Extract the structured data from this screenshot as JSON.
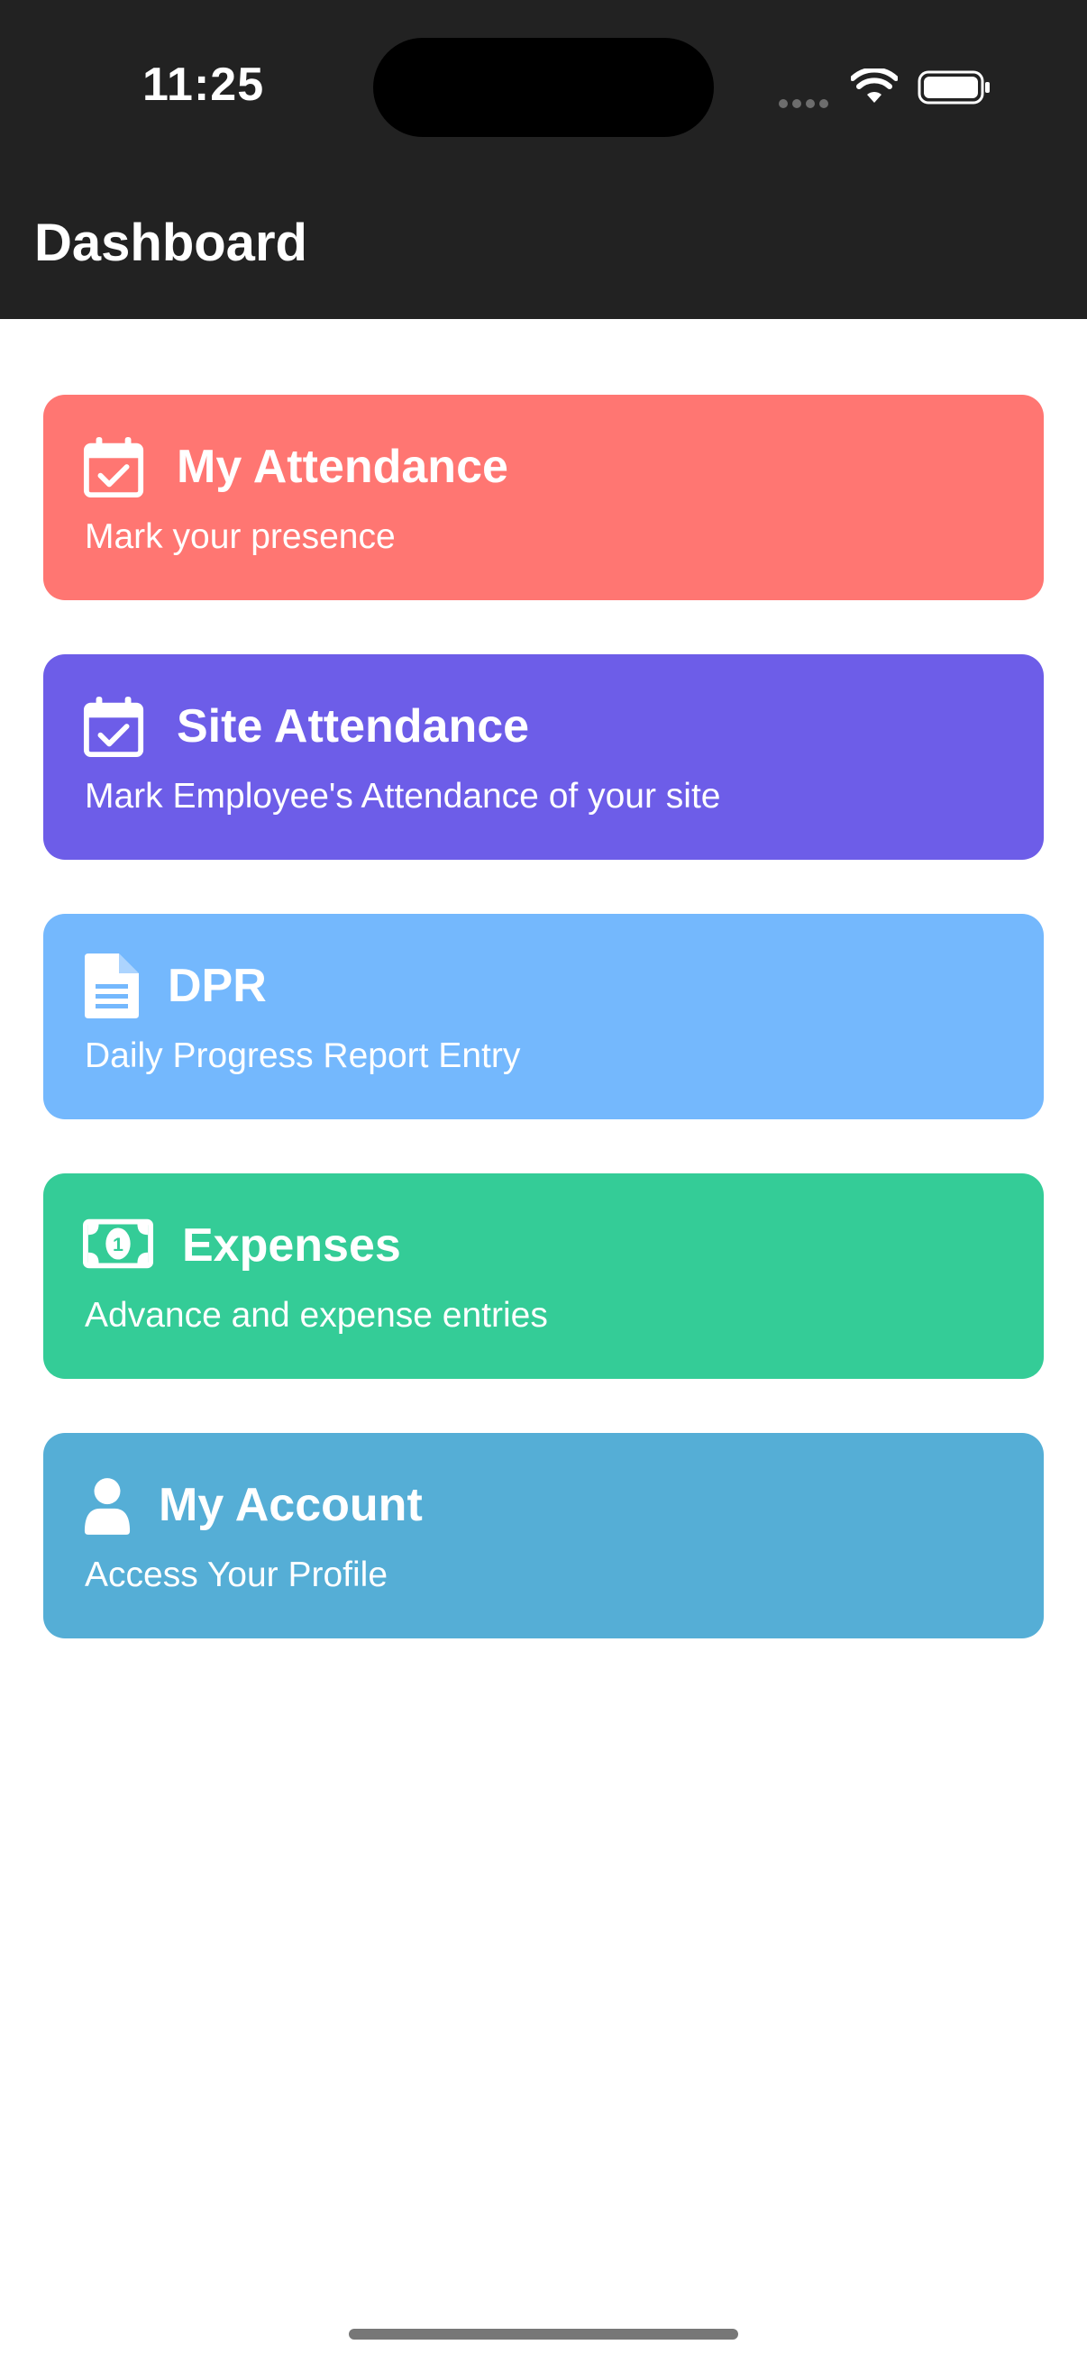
{
  "status_bar": {
    "time": "11:25"
  },
  "header": {
    "title": "Dashboard",
    "background": "#222222"
  },
  "cards": [
    {
      "title": "My Attendance",
      "subtitle": "Mark your presence",
      "icon": "calendar-check-icon",
      "color": "#FF7672"
    },
    {
      "title": "Site Attendance",
      "subtitle": "Mark Employee's Attendance of your site",
      "icon": "calendar-check-icon",
      "color": "#6D5DE8"
    },
    {
      "title": "DPR",
      "subtitle": "Daily Progress Report Entry",
      "icon": "document-icon",
      "color": "#74B8FD"
    },
    {
      "title": "Expenses",
      "subtitle": "Advance and expense entries",
      "icon": "money-bill-icon",
      "color": "#34CC97"
    },
    {
      "title": "My Account",
      "subtitle": "Access Your Profile",
      "icon": "user-icon",
      "color": "#55AED6"
    }
  ]
}
